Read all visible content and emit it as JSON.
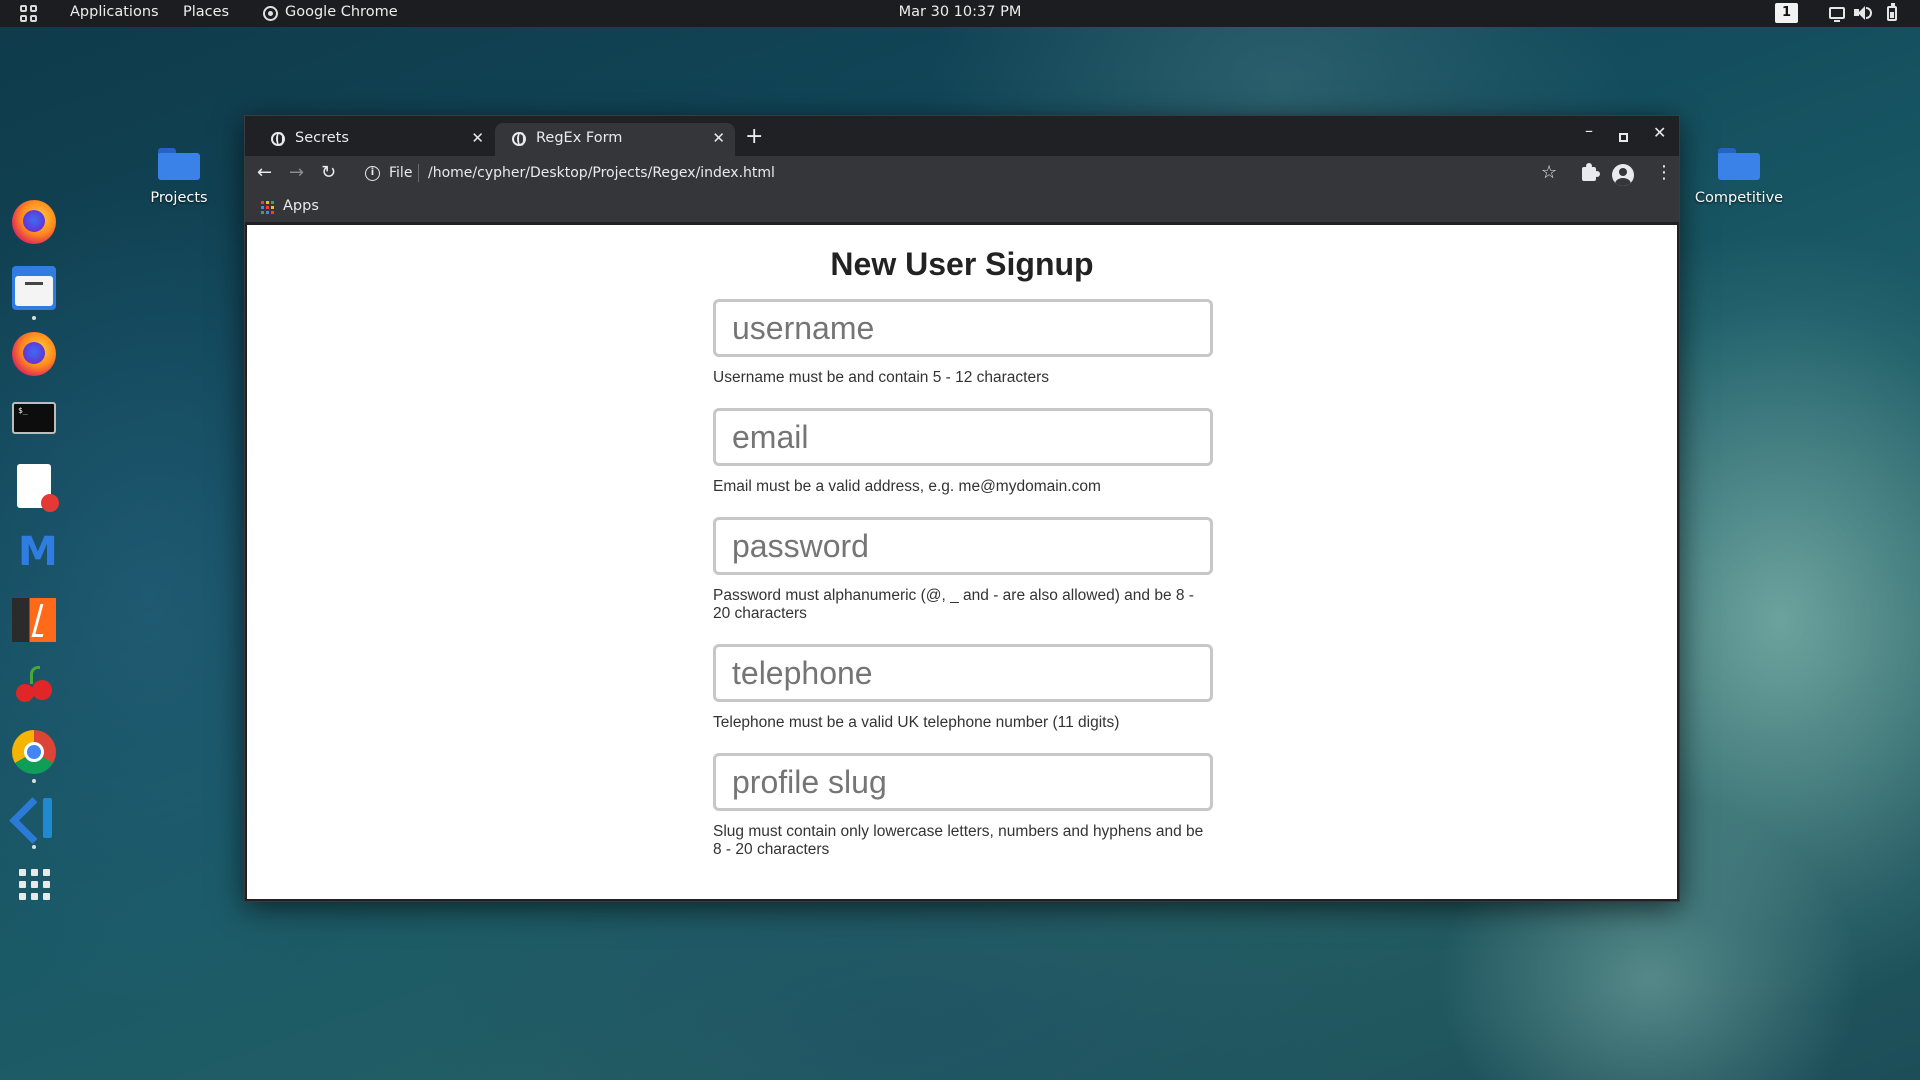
{
  "top_panel": {
    "applications": "Applications",
    "places": "Places",
    "active_app": "Google Chrome",
    "clock": "Mar 30  10:37 PM",
    "workspace": "1"
  },
  "dock": {
    "items": [
      "firefox-icon",
      "files-icon",
      "firefox-icon",
      "terminal-icon",
      "text-editor-icon",
      "maltego-icon",
      "burpsuite-icon",
      "cherrytree-icon",
      "chrome-icon",
      "vscode-icon",
      "show-apps-icon"
    ],
    "terminal_prompt": "$_"
  },
  "desktop": {
    "left_folder": "Projects",
    "right_folder": "Competitive"
  },
  "browser": {
    "tabs": [
      {
        "title": "Secrets",
        "active": false
      },
      {
        "title": "RegEx Form",
        "active": true
      }
    ],
    "new_tab": "+",
    "url_scheme": "File",
    "url": "/home/cypher/Desktop/Projects/Regex/index.html",
    "bookmarks": {
      "apps": "Apps"
    },
    "apps_colors": [
      "#ea4335",
      "#fbbc04",
      "#34a853",
      "#4285f4",
      "#ea4335",
      "#fbbc04",
      "#34a853",
      "#4285f4",
      "#ea4335"
    ]
  },
  "form": {
    "title": "New User Signup",
    "fields": [
      {
        "placeholder": "username",
        "value": "",
        "hint": "Username must be and contain 5 - 12 characters"
      },
      {
        "placeholder": "email",
        "value": "",
        "hint": "Email must be a valid address, e.g. me@mydomain.com"
      },
      {
        "placeholder": "password",
        "value": "",
        "hint": "Password must alphanumeric (@, _ and - are also allowed) and be 8 - 20 characters"
      },
      {
        "placeholder": "telephone",
        "value": "",
        "hint": "Telephone must be a valid UK telephone number (11 digits)"
      },
      {
        "placeholder": "profile slug",
        "value": "",
        "hint": "Slug must contain only lowercase letters, numbers and hyphens and be 8 - 20 characters"
      }
    ]
  },
  "colors": {
    "panel_bg": "#1b1d20",
    "chrome_dark": "#202124",
    "chrome_toolbar": "#35363a",
    "folder_blue": "#3b82e8"
  }
}
